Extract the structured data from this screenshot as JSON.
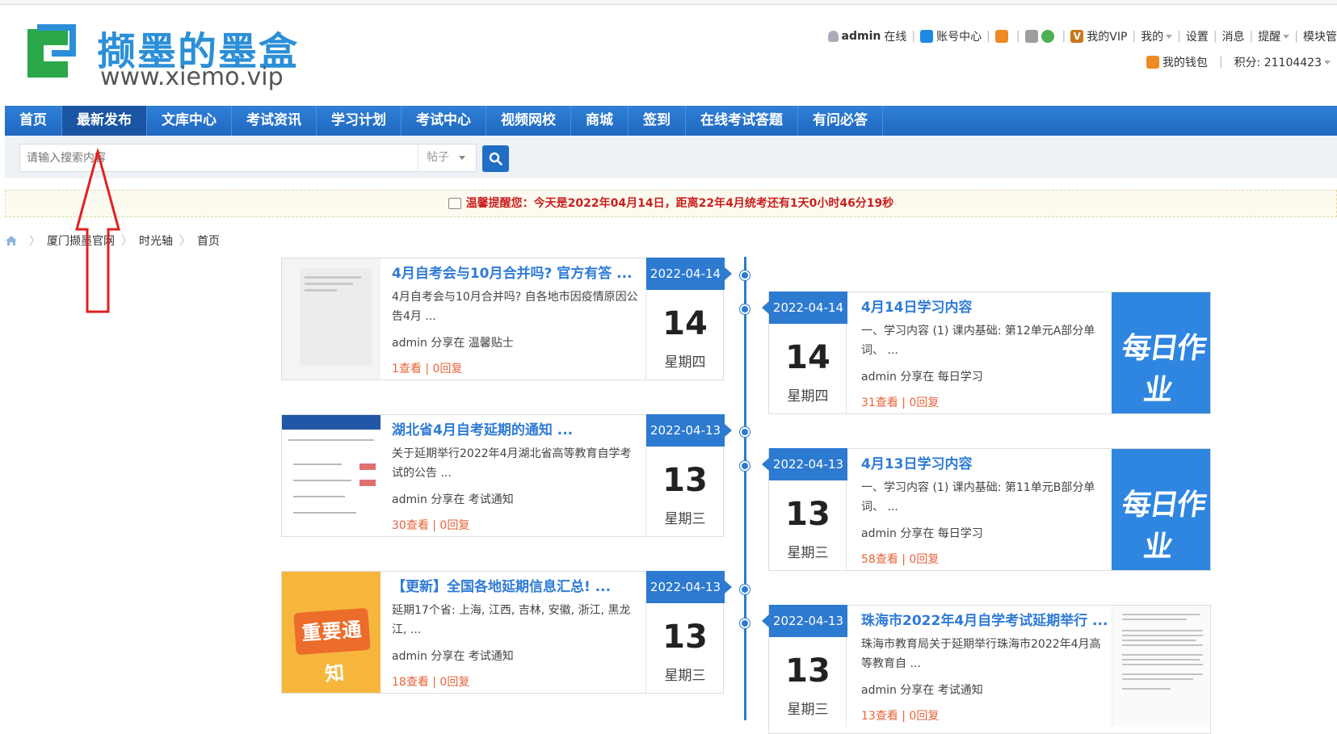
{
  "logo": {
    "cn": "撷墨的墨盒",
    "en": "www.xiemo.vip"
  },
  "userbar": {
    "username": "admin",
    "online": "在线",
    "account_center": "账号中心",
    "my_vip": "我的VIP",
    "mine": "我的",
    "settings": "设置",
    "messages": "消息",
    "remind": "提醒",
    "modules": "模块管",
    "wallet": "我的钱包",
    "points": "积分: 21104423"
  },
  "nav": {
    "items": [
      "首页",
      "最新发布",
      "文库中心",
      "考试资讯",
      "学习计划",
      "考试中心",
      "视频网校",
      "商城",
      "签到",
      "在线考试答题",
      "有问必答"
    ]
  },
  "search": {
    "placeholder": "请输入搜索内容",
    "type": "帖子"
  },
  "notice": {
    "text": "温馨提醒您：今天是2022年04月14日，距离22年4月统考还有1天0小时46分19秒"
  },
  "breadcrumb": {
    "items": [
      "厦门撷墨官网",
      "时光轴",
      "首页"
    ]
  },
  "posts": [
    {
      "title": "4月自考会与10月合并吗? 官方有答 ...",
      "excerpt": "4月自考会与10月合并吗? 自各地市因疫情原因公告4月 ...",
      "meta": "admin 分享在 温馨贴士",
      "stats": "1查看 | 0回复",
      "date": "2022-04-14",
      "day": "14",
      "weekday": "星期四"
    },
    {
      "title": "4月14日学习内容",
      "excerpt": "一、学习内容 (1) 课内基础: 第12单元A部分单词、 ...",
      "meta": "admin 分享在 每日学习",
      "stats": "31查看 | 0回复",
      "date": "2022-04-14",
      "day": "14",
      "weekday": "星期四",
      "thumb_text": "每日作业"
    },
    {
      "title": "湖北省4月自考延期的通知 ...",
      "excerpt": "关于延期举行2022年4月湖北省高等教育自学考试的公告 ...",
      "meta": "admin 分享在 考试通知",
      "stats": "30查看 | 0回复",
      "date": "2022-04-13",
      "day": "13",
      "weekday": "星期三"
    },
    {
      "title": "4月13日学习内容",
      "excerpt": "一、学习内容 (1) 课内基础: 第11单元B部分单词、 ...",
      "meta": "admin 分享在 每日学习",
      "stats": "58查看 | 0回复",
      "date": "2022-04-13",
      "day": "13",
      "weekday": "星期三",
      "thumb_text": "每日作业"
    },
    {
      "title": "【更新】全国各地延期信息汇总! ...",
      "excerpt": "延期17个省: 上海, 江西, 吉林, 安徽, 浙江, 黑龙江, ...",
      "meta": "admin 分享在 考试通知",
      "stats": "18查看 | 0回复",
      "date": "2022-04-13",
      "day": "13",
      "weekday": "星期三",
      "thumb_text": "重要通知"
    },
    {
      "title": "珠海市2022年4月自学考试延期举行 ...",
      "excerpt": "珠海市教育局关于延期举行珠海市2022年4月高等教育自 ...",
      "meta": "admin 分享在 考试通知",
      "stats": "13查看 | 0回复",
      "date": "2022-04-13",
      "day": "13",
      "weekday": "星期三"
    }
  ],
  "colors": {
    "primary": "#2d7ad1",
    "nav_active": "#1a55a3",
    "accent_red": "#c91f1f",
    "stats_orange": "#e8643a",
    "arrow_red": "#e02020"
  },
  "icons": [
    "home-icon",
    "search-icon",
    "user-icon",
    "account-icon",
    "wallet-icon",
    "vip-icon",
    "arrow-annotation"
  ]
}
